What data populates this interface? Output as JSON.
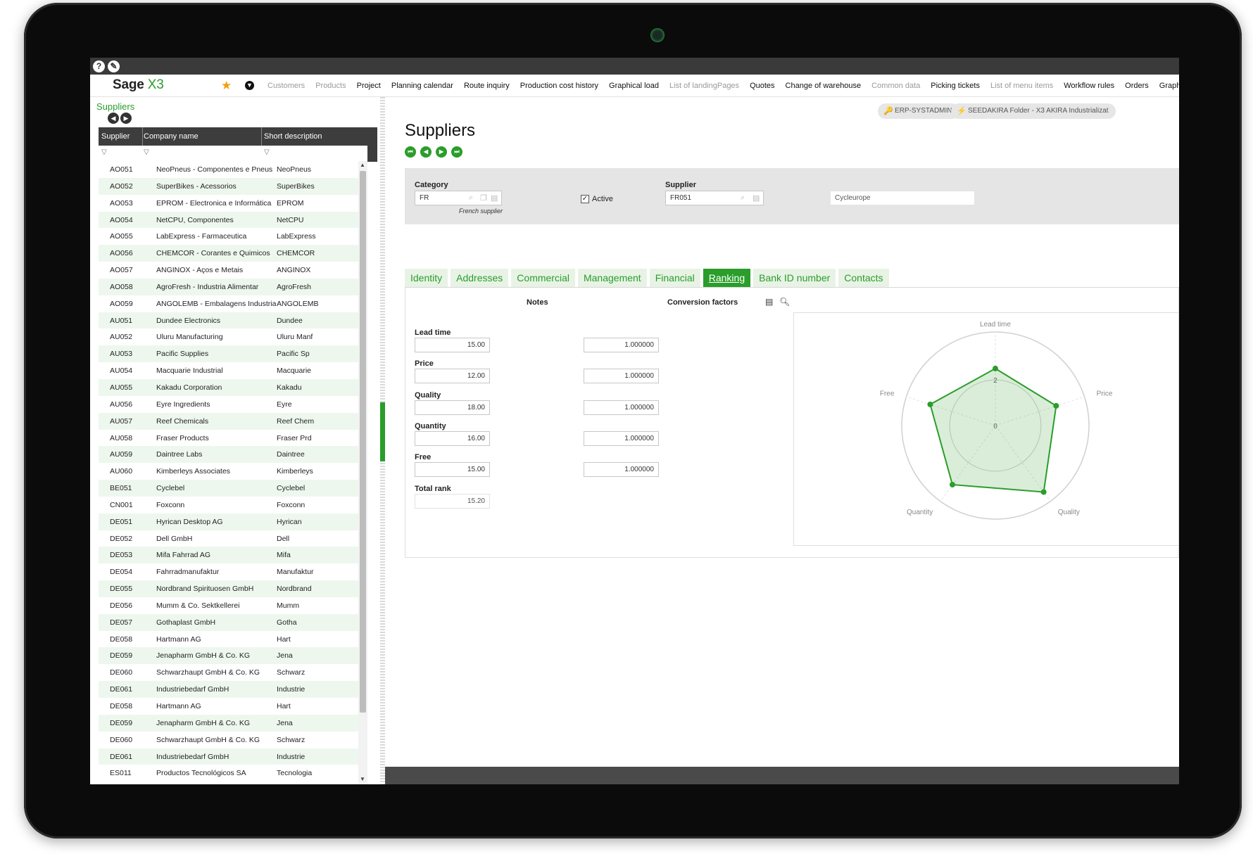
{
  "menubar": {
    "brand": "Sage",
    "brand_suffix": "X3",
    "items": [
      {
        "label": "Customers",
        "dim": true
      },
      {
        "label": "Products",
        "dim": true
      },
      {
        "label": "Project",
        "dim": false
      },
      {
        "label": "Planning calendar",
        "dim": false
      },
      {
        "label": "Route inquiry",
        "dim": false
      },
      {
        "label": "Production cost history",
        "dim": false
      },
      {
        "label": "Graphical load",
        "dim": false
      },
      {
        "label": "List of landingPages",
        "dim": true
      },
      {
        "label": "Quotes",
        "dim": false
      },
      {
        "label": "Change of warehouse",
        "dim": false
      },
      {
        "label": "Common data",
        "dim": true
      },
      {
        "label": "Picking tickets",
        "dim": false
      },
      {
        "label": "List of menu items",
        "dim": true
      },
      {
        "label": "Workflow rules",
        "dim": false
      },
      {
        "label": "Orders",
        "dim": false
      },
      {
        "label": "Graphical query tool",
        "dim": false
      }
    ]
  },
  "left": {
    "title": "Suppliers",
    "columns": [
      "Supplier",
      "Company name",
      "Short description"
    ],
    "rows": [
      [
        "AO051",
        "NeoPneus - Componentes e Pneus",
        "NeoPneus"
      ],
      [
        "AO052",
        "SuperBikes - Acessorios",
        "SuperBikes"
      ],
      [
        "AO053",
        "EPROM - Electronica e Informática",
        "EPROM"
      ],
      [
        "AO054",
        "NetCPU, Componentes",
        "NetCPU"
      ],
      [
        "AO055",
        "LabExpress - Farmaceutica",
        "LabExpress"
      ],
      [
        "AO056",
        "CHEMCOR - Corantes e Quimicos",
        "CHEMCOR"
      ],
      [
        "AO057",
        "ANGINOX - Aços e Metais",
        "ANGINOX"
      ],
      [
        "AO058",
        "AgroFresh - Industria Alimentar",
        "AgroFresh"
      ],
      [
        "AO059",
        "ANGOLEMB - Embalagens Industriais",
        "ANGOLEMB"
      ],
      [
        "AU051",
        "Dundee Electronics",
        "Dundee"
      ],
      [
        "AU052",
        "Uluru Manufacturing",
        "Uluru Manf"
      ],
      [
        "AU053",
        "Pacific Supplies",
        "Pacific Sp"
      ],
      [
        "AU054",
        "Macquarie Industrial",
        "Macquarie"
      ],
      [
        "AU055",
        "Kakadu Corporation",
        "Kakadu"
      ],
      [
        "AU056",
        "Eyre Ingredients",
        "Eyre"
      ],
      [
        "AU057",
        "Reef Chemicals",
        "Reef Chem"
      ],
      [
        "AU058",
        "Fraser Products",
        "Fraser Prd"
      ],
      [
        "AU059",
        "Daintree Labs",
        "Daintree"
      ],
      [
        "AU060",
        "Kimberleys Associates",
        "Kimberleys"
      ],
      [
        "BE051",
        "Cyclebel",
        "Cyclebel"
      ],
      [
        "CN001",
        "Foxconn",
        "Foxconn"
      ],
      [
        "DE051",
        "Hyrican Desktop AG",
        "Hyrican"
      ],
      [
        "DE052",
        "Dell GmbH",
        "Dell"
      ],
      [
        "DE053",
        "Mifa Fahrrad AG",
        "Mifa"
      ],
      [
        "DE054",
        "Fahrradmanufaktur",
        "Manufaktur"
      ],
      [
        "DE055",
        "Nordbrand Spirituosen GmbH",
        "Nordbrand"
      ],
      [
        "DE056",
        "Mumm & Co. Sektkellerei",
        "Mumm"
      ],
      [
        "DE057",
        "Gothaplast GmbH",
        "Gotha"
      ],
      [
        "DE058",
        "Hartmann AG",
        "Hart"
      ],
      [
        "DE059",
        "Jenapharm GmbH & Co. KG",
        "Jena"
      ],
      [
        "DE060",
        "Schwarzhaupt GmbH & Co. KG",
        "Schwarz"
      ],
      [
        "DE061",
        "Industriebedarf GmbH",
        "Industrie"
      ],
      [
        "DE058",
        "Hartmann AG",
        "Hart"
      ],
      [
        "DE059",
        "Jenapharm GmbH & Co. KG",
        "Jena"
      ],
      [
        "DE060",
        "Schwarzhaupt GmbH & Co. KG",
        "Schwarz"
      ],
      [
        "DE061",
        "Industriebedarf GmbH",
        "Industrie"
      ],
      [
        "ES011",
        "Productos Tecnológicos SA",
        "Tecnologia"
      ]
    ]
  },
  "right": {
    "chips": [
      "ERP-SYSTADMIN",
      "SEEDAKIRA Folder - X3 AKIRA Industrializat"
    ],
    "title": "Suppliers",
    "header": {
      "category_label": "Category",
      "category_value": "FR",
      "category_desc": "French supplier",
      "active_label": "Active",
      "active_checked": "✓",
      "supplier_label": "Supplier",
      "supplier_value": "FR051",
      "supplier_name": "Cycleurope"
    },
    "tabs": [
      "Identity",
      "Addresses",
      "Commercial",
      "Management",
      "Financial",
      "Ranking",
      "Bank ID number",
      "Contacts"
    ],
    "active_tab": "Ranking",
    "notes_title": "Notes",
    "conv_title": "Conversion factors",
    "fields": [
      {
        "label": "Lead time",
        "note": "15.00",
        "factor": "1.000000"
      },
      {
        "label": "Price",
        "note": "12.00",
        "factor": "1.000000"
      },
      {
        "label": "Quality",
        "note": "18.00",
        "factor": "1.000000"
      },
      {
        "label": "Quantity",
        "note": "16.00",
        "factor": "1.000000"
      },
      {
        "label": "Free",
        "note": "15.00",
        "factor": "1.000000"
      }
    ],
    "total_label": "Total rank",
    "total_value": "15.20"
  },
  "chart_data": {
    "type": "radar",
    "axes": [
      "Lead time",
      "Price",
      "Quality",
      "Quantity",
      "Free"
    ],
    "values": [
      2.5,
      2.8,
      3.6,
      3.2,
      3.0
    ],
    "rings": [
      0,
      2
    ],
    "max": 4.1,
    "color": "#2a9d2a"
  }
}
